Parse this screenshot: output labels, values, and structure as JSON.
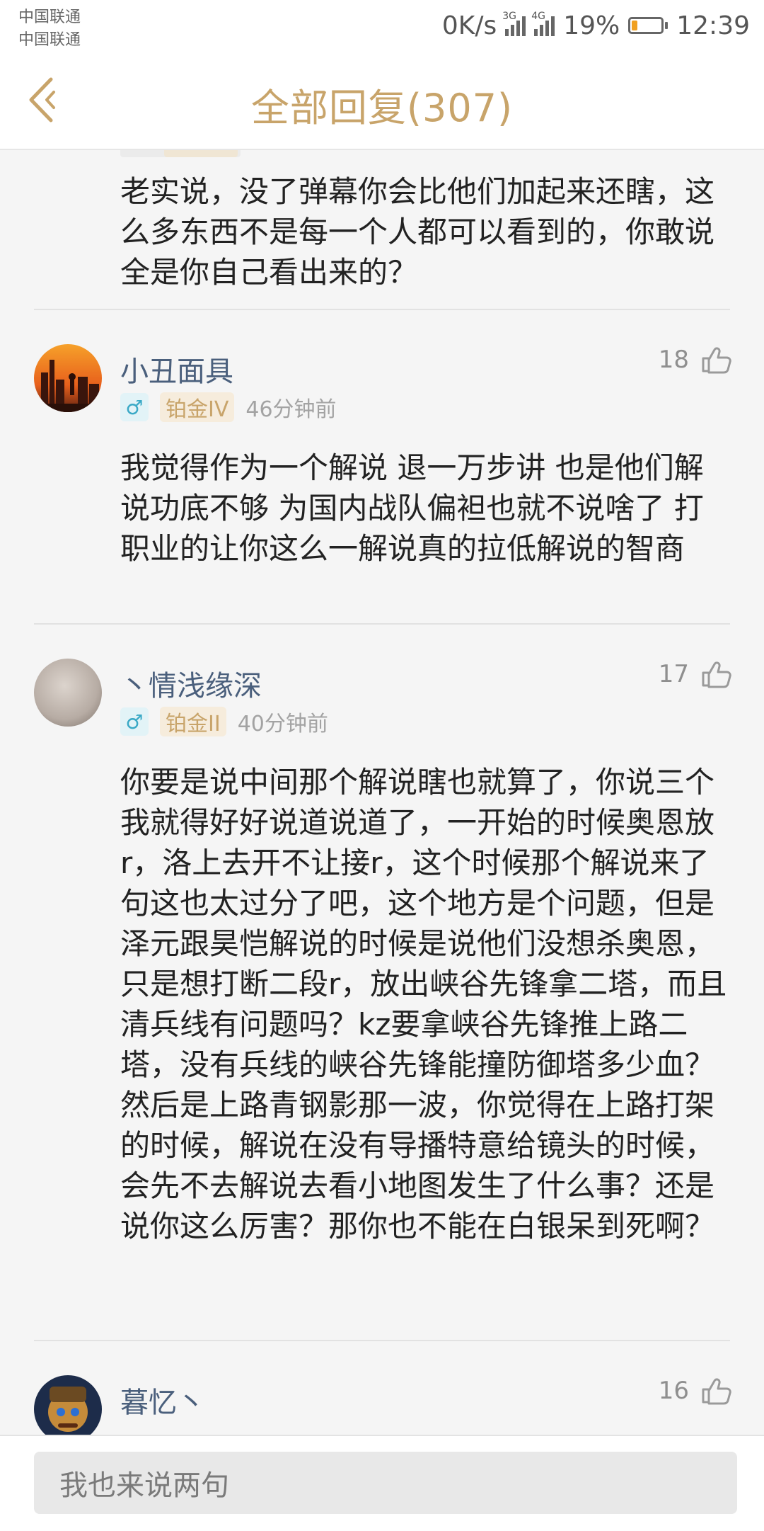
{
  "status_bar": {
    "carrier_1": "中国联通",
    "carrier_2": "中国联通",
    "speed": "0K/s",
    "network_1": "3G",
    "network_2": "4G",
    "battery_level": 0.19,
    "battery": "19%",
    "time": "12:39"
  },
  "header": {
    "back_icon": "chevron-left-icon",
    "title": "全部回复(307)"
  },
  "feed": {
    "top_comment_text": "老实说，没了弹幕你会比他们加起来还瞎，这么多东西不是每一个人都可以看到的，你敢说全是你自己看出来的？",
    "comments": [
      {
        "username": "小丑面具",
        "likes": "18",
        "gender_icon": "male-icon",
        "gender": "♂",
        "rank": "铂金IV",
        "time": "46分钟前",
        "text": "我觉得作为一个解说 退一万步讲 也是他们解说功底不够  为国内战队偏袒也就不说啥了 打职业的让你这么一解说真的拉低解说的智商"
      },
      {
        "username": "丶情浅缘深",
        "likes": "17",
        "gender_icon": "male-icon",
        "gender": "♂",
        "rank": "铂金II",
        "time": "40分钟前",
        "text": "你要是说中间那个解说瞎也就算了，你说三个我就得好好说道说道了，一开始的时候奥恩放r，洛上去开不让接r，这个时候那个解说来了句这也太过分了吧，这个地方是个问题，但是泽元跟昊恺解说的时候是说他们没想杀奥恩，只是想打断二段r，放出峡谷先锋拿二塔，而且清兵线有问题吗？kz要拿峡谷先锋推上路二塔，没有兵线的峡谷先锋能撞防御塔多少血？然后是上路青钢影那一波，你觉得在上路打架的时候，解说在没有导播特意给镜头的时候，会先不去解说去看小地图发生了什么事？还是说你这么厉害？那你也不能在白银呆到死啊？"
      },
      {
        "username": "暮忆丶",
        "likes": "16"
      }
    ]
  },
  "composer": {
    "placeholder": "我也来说两句"
  },
  "colors": {
    "accent_gold": "#c8a46a",
    "username_blue": "#4a5f7c",
    "gender_teal": "#3aa9c6"
  }
}
